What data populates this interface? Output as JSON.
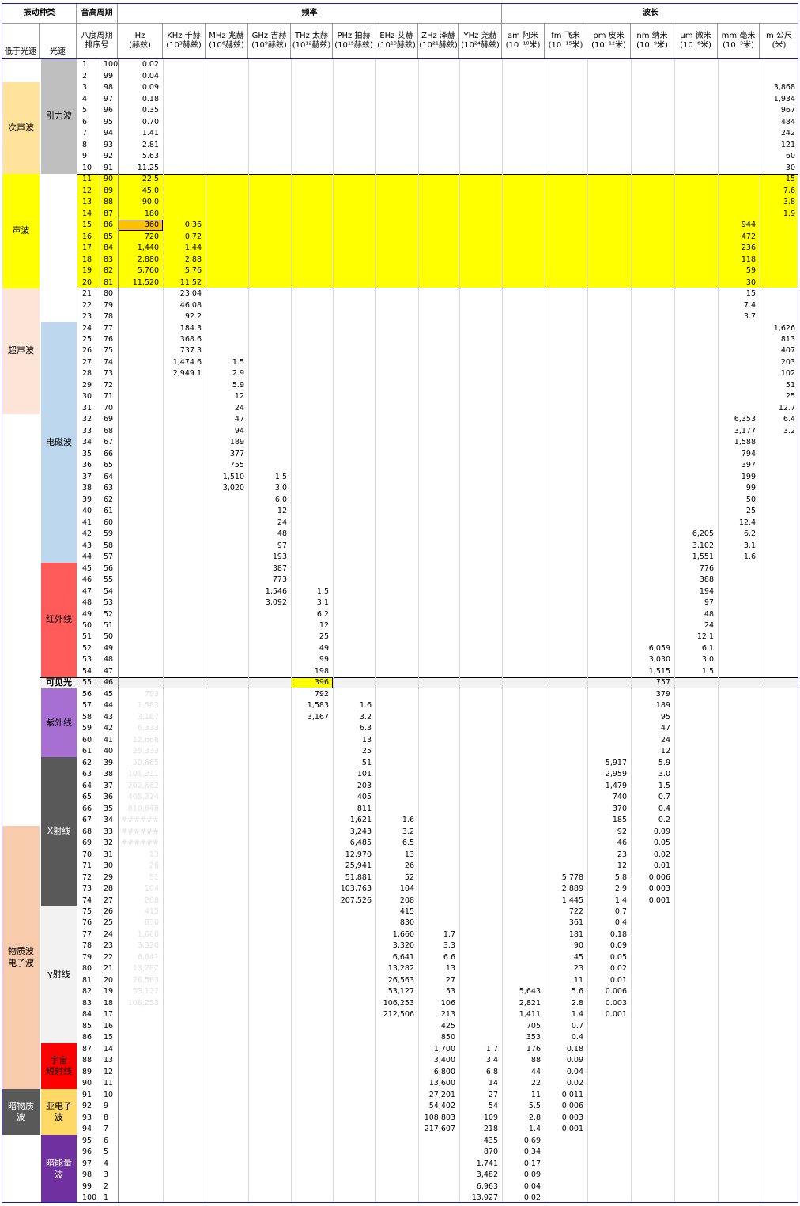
{
  "header": {
    "vibration_type": "振动种类",
    "cycle": "音高周期",
    "frequency": "频率",
    "wavelength": "波长",
    "sub_left": "低于光速",
    "sub_light": "光速",
    "octave": "八度周期",
    "order": "排序号",
    "freq_units": [
      {
        "l1": "Hz",
        "l2": "(赫兹)"
      },
      {
        "l1": "KHz 千赫",
        "l2": "(10³赫兹)"
      },
      {
        "l1": "MHz 兆赫",
        "l2": "(10⁶赫兹)"
      },
      {
        "l1": "GHz 吉赫",
        "l2": "(10⁹赫兹)"
      },
      {
        "l1": "THz 太赫",
        "l2": "(10¹²赫兹)"
      },
      {
        "l1": "PHz 拍赫",
        "l2": "(10¹⁵赫兹)"
      },
      {
        "l1": "EHz 艾赫",
        "l2": "(10¹⁸赫兹)"
      },
      {
        "l1": "ZHz 泽赫",
        "l2": "(10²¹赫兹)"
      },
      {
        "l1": "YHz 尧赫",
        "l2": "(10²⁴赫兹)"
      }
    ],
    "wave_units": [
      {
        "l1": "am 阿米",
        "l2": "(10⁻¹⁸米)"
      },
      {
        "l1": "fm 飞米",
        "l2": "(10⁻¹⁵米)"
      },
      {
        "l1": "pm 皮米",
        "l2": "(10⁻¹²米)"
      },
      {
        "l1": "nm 纳米",
        "l2": "(10⁻⁹米)"
      },
      {
        "l1": "μm 微米",
        "l2": "(10⁻⁶米)"
      },
      {
        "l1": "mm 毫米",
        "l2": "(10⁻³米)"
      },
      {
        "l1": "m 公尺",
        "l2": "(米)"
      }
    ]
  },
  "colors": {
    "infrasound": "#ffe39a",
    "sound": "#ffff00",
    "ultrasound": "#fce4d6",
    "matter": "#f8cbad",
    "darkmatter": "#595959",
    "gravity": "#bfbfbf",
    "em": "#bdd7ee",
    "ir": "#ff5b5b",
    "uv": "#a66fd1",
    "xray": "#595959",
    "gamma": "#f2f2f2",
    "cosmic": "#ff0000",
    "subelectron": "#ffd966",
    "darkenergy": "#7030a0",
    "highlight_orange": "#ffc000"
  },
  "left_categories": [
    {
      "label": "次声波",
      "from": 3,
      "to": 10,
      "color": "infrasound"
    },
    {
      "label": "声波",
      "from": 11,
      "to": 20,
      "color": "sound"
    },
    {
      "label": "超声波",
      "from": 21,
      "to": 31,
      "color": "ultrasound"
    },
    {
      "label": "物质波\n电子波",
      "from": 68,
      "to": 90,
      "color": "matter"
    },
    {
      "label": "暗物质\n波",
      "from": 91,
      "to": 94,
      "color": "darkmatter",
      "text": "#ffffff"
    }
  ],
  "light_categories": [
    {
      "label": "引力波",
      "from": 1,
      "to": 10,
      "color": "gravity"
    },
    {
      "label": "电磁波",
      "from": 24,
      "to": 44,
      "color": "em"
    },
    {
      "label": "红外线",
      "from": 45,
      "to": 54,
      "color": "ir"
    },
    {
      "label": "可见光",
      "from": 55,
      "to": 55,
      "color": "none",
      "bold": true
    },
    {
      "label": "紫外线",
      "from": 56,
      "to": 61,
      "color": "uv"
    },
    {
      "label": "X射线",
      "from": 62,
      "to": 74,
      "color": "xray",
      "text": "#ffffff"
    },
    {
      "label": "γ射线",
      "from": 75,
      "to": 86,
      "color": "gamma"
    },
    {
      "label": "宇宙\n短射线",
      "from": 87,
      "to": 90,
      "color": "cosmic"
    },
    {
      "label": "亚电子\n波",
      "from": 91,
      "to": 94,
      "color": "subelectron"
    },
    {
      "label": "暗能量\n波",
      "from": 95,
      "to": 100,
      "color": "darkenergy",
      "text": "#ffffff"
    }
  ],
  "rows": [
    {
      "n": "1",
      "o": "100",
      "hz": "0.02"
    },
    {
      "n": "2",
      "o": "99",
      "hz": "0.04"
    },
    {
      "n": "3",
      "o": "98",
      "hz": "0.09",
      "m": "3,868"
    },
    {
      "n": "4",
      "o": "97",
      "hz": "0.18",
      "m": "1,934"
    },
    {
      "n": "5",
      "o": "96",
      "hz": "0.35",
      "m": "967"
    },
    {
      "n": "6",
      "o": "95",
      "hz": "0.70",
      "m": "484"
    },
    {
      "n": "7",
      "o": "94",
      "hz": "1.41",
      "m": "242"
    },
    {
      "n": "8",
      "o": "93",
      "hz": "2.81",
      "m": "121"
    },
    {
      "n": "9",
      "o": "92",
      "hz": "5.63",
      "m": "60"
    },
    {
      "n": "10",
      "o": "91",
      "hz": "11.25",
      "m": "30"
    },
    {
      "n": "11",
      "o": "90",
      "hz": "22.5",
      "m": "15"
    },
    {
      "n": "12",
      "o": "89",
      "hz": "45.0",
      "m": "7.6"
    },
    {
      "n": "13",
      "o": "88",
      "hz": "90.0",
      "m": "3.8"
    },
    {
      "n": "14",
      "o": "87",
      "hz": "180",
      "m": "1.9"
    },
    {
      "n": "15",
      "o": "86",
      "hz": "360",
      "khz": "0.36",
      "mm": "944"
    },
    {
      "n": "16",
      "o": "85",
      "hz": "720",
      "khz": "0.72",
      "mm": "472"
    },
    {
      "n": "17",
      "o": "84",
      "hz": "1,440",
      "khz": "1.44",
      "mm": "236"
    },
    {
      "n": "18",
      "o": "83",
      "hz": "2,880",
      "khz": "2.88",
      "mm": "118"
    },
    {
      "n": "19",
      "o": "82",
      "hz": "5,760",
      "khz": "5.76",
      "mm": "59"
    },
    {
      "n": "20",
      "o": "81",
      "hz": "11,520",
      "khz": "11.52",
      "mm": "30"
    },
    {
      "n": "21",
      "o": "80",
      "khz": "23.04",
      "mm": "15"
    },
    {
      "n": "22",
      "o": "79",
      "khz": "46.08",
      "mm": "7.4"
    },
    {
      "n": "23",
      "o": "78",
      "khz": "92.2",
      "mm": "3.7"
    },
    {
      "n": "24",
      "o": "77",
      "khz": "184.3",
      "m": "1,626"
    },
    {
      "n": "25",
      "o": "76",
      "khz": "368.6",
      "m": "813"
    },
    {
      "n": "26",
      "o": "75",
      "khz": "737.3",
      "m": "407"
    },
    {
      "n": "27",
      "o": "74",
      "khz": "1,474.6",
      "mhz": "1.5",
      "m": "203"
    },
    {
      "n": "28",
      "o": "73",
      "khz": "2,949.1",
      "mhz": "2.9",
      "m": "102"
    },
    {
      "n": "29",
      "o": "72",
      "mhz": "5.9",
      "m": "51"
    },
    {
      "n": "30",
      "o": "71",
      "mhz": "12",
      "m": "25"
    },
    {
      "n": "31",
      "o": "70",
      "mhz": "24",
      "m": "12.7"
    },
    {
      "n": "32",
      "o": "69",
      "mhz": "47",
      "mm": "6,353",
      "m": "6.4"
    },
    {
      "n": "33",
      "o": "68",
      "mhz": "94",
      "mm": "3,177",
      "m": "3.2"
    },
    {
      "n": "34",
      "o": "67",
      "mhz": "189",
      "mm": "1,588"
    },
    {
      "n": "35",
      "o": "66",
      "mhz": "377",
      "mm": "794"
    },
    {
      "n": "36",
      "o": "65",
      "mhz": "755",
      "mm": "397"
    },
    {
      "n": "37",
      "o": "64",
      "mhz": "1,510",
      "ghz": "1.5",
      "mm": "199"
    },
    {
      "n": "38",
      "o": "63",
      "mhz": "3,020",
      "ghz": "3.0",
      "mm": "99"
    },
    {
      "n": "39",
      "o": "62",
      "ghz": "6.0",
      "mm": "50"
    },
    {
      "n": "40",
      "o": "61",
      "ghz": "12",
      "mm": "25"
    },
    {
      "n": "41",
      "o": "60",
      "ghz": "24",
      "mm": "12.4"
    },
    {
      "n": "42",
      "o": "59",
      "ghz": "48",
      "um": "6,205",
      "mm": "6.2"
    },
    {
      "n": "43",
      "o": "58",
      "ghz": "97",
      "um": "3,102",
      "mm": "3.1"
    },
    {
      "n": "44",
      "o": "57",
      "ghz": "193",
      "um": "1,551",
      "mm": "1.6"
    },
    {
      "n": "45",
      "o": "56",
      "ghz": "387",
      "um": "776"
    },
    {
      "n": "46",
      "o": "55",
      "ghz": "773",
      "um": "388"
    },
    {
      "n": "47",
      "o": "54",
      "ghz": "1,546",
      "thz": "1.5",
      "um": "194"
    },
    {
      "n": "48",
      "o": "53",
      "ghz": "3,092",
      "thz": "3.1",
      "um": "97"
    },
    {
      "n": "49",
      "o": "52",
      "thz": "6.2",
      "um": "48"
    },
    {
      "n": "50",
      "o": "51",
      "thz": "12",
      "um": "24"
    },
    {
      "n": "51",
      "o": "50",
      "thz": "25",
      "um": "12.1"
    },
    {
      "n": "52",
      "o": "49",
      "thz": "49",
      "nm": "6,059",
      "um": "6.1"
    },
    {
      "n": "53",
      "o": "48",
      "thz": "99",
      "nm": "3,030",
      "um": "3.0"
    },
    {
      "n": "54",
      "o": "47",
      "thz": "198",
      "nm": "1,515",
      "um": "1.5"
    },
    {
      "n": "55",
      "o": "46",
      "thz": "396",
      "nm": "757"
    },
    {
      "n": "56",
      "o": "45",
      "hz": "793",
      "thz": "792",
      "nm": "379"
    },
    {
      "n": "57",
      "o": "44",
      "hz": "1,583",
      "thz": "1,583",
      "phz": "1.6",
      "nm": "189"
    },
    {
      "n": "58",
      "o": "43",
      "hz": "3,167",
      "thz": "3,167",
      "phz": "3.2",
      "nm": "95"
    },
    {
      "n": "59",
      "o": "42",
      "hz": "6,333",
      "phz": "6.3",
      "nm": "47"
    },
    {
      "n": "60",
      "o": "41",
      "hz": "12,666",
      "phz": "13",
      "nm": "24"
    },
    {
      "n": "61",
      "o": "40",
      "hz": "25,333",
      "phz": "25",
      "nm": "12"
    },
    {
      "n": "62",
      "o": "39",
      "hz": "50,665",
      "phz": "51",
      "pm": "5,917",
      "nm": "5.9"
    },
    {
      "n": "63",
      "o": "38",
      "hz": "101,331",
      "phz": "101",
      "pm": "2,959",
      "nm": "3.0"
    },
    {
      "n": "64",
      "o": "37",
      "hz": "202,662",
      "phz": "203",
      "pm": "1,479",
      "nm": "1.5"
    },
    {
      "n": "65",
      "o": "36",
      "hz": "405,324",
      "phz": "405",
      "pm": "740",
      "nm": "0.7"
    },
    {
      "n": "66",
      "o": "35",
      "hz": "810,648",
      "phz": "811",
      "pm": "370",
      "nm": "0.4"
    },
    {
      "n": "67",
      "o": "34",
      "hz": "######",
      "phz": "1,621",
      "ehz": "1.6",
      "pm": "185",
      "nm": "0.2"
    },
    {
      "n": "68",
      "o": "33",
      "hz": "######",
      "phz": "3,243",
      "ehz": "3.2",
      "pm": "92",
      "nm": "0.09"
    },
    {
      "n": "69",
      "o": "32",
      "hz": "######",
      "phz": "6,485",
      "ehz": "6.5",
      "pm": "46",
      "nm": "0.05"
    },
    {
      "n": "70",
      "o": "31",
      "hz": "13",
      "phz": "12,970",
      "ehz": "13",
      "pm": "23",
      "nm": "0.02"
    },
    {
      "n": "71",
      "o": "30",
      "hz": "26",
      "phz": "25,941",
      "ehz": "26",
      "pm": "12",
      "nm": "0.01"
    },
    {
      "n": "72",
      "o": "29",
      "hz": "51",
      "phz": "51,881",
      "ehz": "52",
      "fm": "5,778",
      "pm": "5.8",
      "nm": "0.006"
    },
    {
      "n": "73",
      "o": "28",
      "hz": "104",
      "phz": "103,763",
      "ehz": "104",
      "fm": "2,889",
      "pm": "2.9",
      "nm": "0.003"
    },
    {
      "n": "74",
      "o": "27",
      "hz": "208",
      "phz": "207,526",
      "ehz": "208",
      "fm": "1,445",
      "pm": "1.4",
      "nm": "0.001"
    },
    {
      "n": "75",
      "o": "26",
      "hz": "415",
      "ehz": "415",
      "fm": "722",
      "pm": "0.7"
    },
    {
      "n": "76",
      "o": "25",
      "hz": "830",
      "ehz": "830",
      "fm": "361",
      "pm": "0.4"
    },
    {
      "n": "77",
      "o": "24",
      "hz": "1,660",
      "ehz": "1,660",
      "zhz": "1.7",
      "fm": "181",
      "pm": "0.18"
    },
    {
      "n": "78",
      "o": "23",
      "hz": "3,320",
      "ehz": "3,320",
      "zhz": "3.3",
      "fm": "90",
      "pm": "0.09"
    },
    {
      "n": "79",
      "o": "22",
      "hz": "6,641",
      "ehz": "6,641",
      "zhz": "6.6",
      "fm": "45",
      "pm": "0.05"
    },
    {
      "n": "80",
      "o": "21",
      "hz": "13,282",
      "ehz": "13,282",
      "zhz": "13",
      "fm": "23",
      "pm": "0.02"
    },
    {
      "n": "81",
      "o": "20",
      "hz": "26,563",
      "ehz": "26,563",
      "zhz": "27",
      "fm": "11",
      "pm": "0.01"
    },
    {
      "n": "82",
      "o": "19",
      "hz": "53,127",
      "ehz": "53,127",
      "zhz": "53",
      "am": "5,643",
      "fm": "5.6",
      "pm": "0.006"
    },
    {
      "n": "83",
      "o": "18",
      "hz": "106,253",
      "ehz": "106,253",
      "zhz": "106",
      "am": "2,821",
      "fm": "2.8",
      "pm": "0.003"
    },
    {
      "n": "84",
      "o": "17",
      "ehz": "212,506",
      "zhz": "213",
      "am": "1,411",
      "fm": "1.4",
      "pm": "0.001"
    },
    {
      "n": "85",
      "o": "16",
      "zhz": "425",
      "am": "705",
      "fm": "0.7"
    },
    {
      "n": "86",
      "o": "15",
      "zhz": "850",
      "am": "353",
      "fm": "0.4"
    },
    {
      "n": "87",
      "o": "14",
      "zhz": "1,700",
      "yhz": "1.7",
      "am": "176",
      "fm": "0.18"
    },
    {
      "n": "88",
      "o": "13",
      "zhz": "3,400",
      "yhz": "3.4",
      "am": "88",
      "fm": "0.09"
    },
    {
      "n": "89",
      "o": "12",
      "zhz": "6,800",
      "yhz": "6.8",
      "am": "44",
      "fm": "0.04"
    },
    {
      "n": "90",
      "o": "11",
      "zhz": "13,600",
      "yhz": "14",
      "am": "22",
      "fm": "0.02"
    },
    {
      "n": "91",
      "o": "10",
      "zhz": "27,201",
      "yhz": "27",
      "am": "11",
      "fm": "0.011"
    },
    {
      "n": "92",
      "o": "9",
      "zhz": "54,402",
      "yhz": "54",
      "am": "5.5",
      "fm": "0.006"
    },
    {
      "n": "93",
      "o": "8",
      "zhz": "108,803",
      "yhz": "109",
      "am": "2.8",
      "fm": "0.003"
    },
    {
      "n": "94",
      "o": "7",
      "zhz": "217,607",
      "yhz": "218",
      "am": "1.4",
      "fm": "0.001"
    },
    {
      "n": "95",
      "o": "6",
      "yhz": "435",
      "am": "0.69"
    },
    {
      "n": "96",
      "o": "5",
      "yhz": "870",
      "am": "0.34"
    },
    {
      "n": "97",
      "o": "4",
      "yhz": "1,741",
      "am": "0.17"
    },
    {
      "n": "98",
      "o": "3",
      "yhz": "3,482",
      "am": "0.09"
    },
    {
      "n": "99",
      "o": "2",
      "yhz": "6,963",
      "am": "0.04"
    },
    {
      "n": "100",
      "o": "1",
      "yhz": "13,927",
      "am": "0.02"
    }
  ]
}
